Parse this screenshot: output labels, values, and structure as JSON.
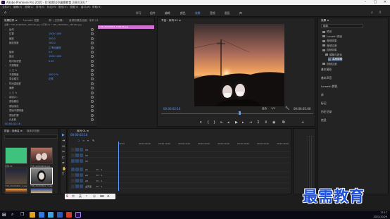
{
  "window": {
    "title": "Adobe Premiere Pro 2020 - D:\\视频\\10\\最需教育 2(8)\\(30).*",
    "controls": [
      "–",
      "□",
      "✕"
    ]
  },
  "menu": [
    "文件(F)",
    "编辑(E)",
    "剪辑(C)",
    "序列(S)",
    "标记(M)",
    "图形(G)",
    "视图(V)",
    "窗口(W)",
    "帮助(H)"
  ],
  "workspaces": {
    "items": [
      "学习",
      "组件",
      "编辑",
      "颜色",
      "效果",
      "音频",
      "图形",
      "库"
    ],
    "active_index": 4
  },
  "effect_controls": {
    "tabs": [
      "效果控件 ≡",
      "Lumetri 范围",
      "源：(无剪辑)",
      "音频剪辑混合器：序列 01"
    ],
    "source_line": "主要 * Y98_20200601_180146.jpg ∨ 序列 01 * Y98_20200601_180146.jpg",
    "clip_name": "Y98_20200601_180146.jpg",
    "rows": [
      {
        "label": "运动",
        "value": ""
      },
      {
        "label": "位置",
        "value": "1500   1000"
      },
      {
        "label": "缩放",
        "value": "200.0"
      },
      {
        "label": "缩放宽度",
        "value": "100.0"
      },
      {
        "label": "",
        "value": "☑ 等比缩放"
      },
      {
        "label": "旋转",
        "value": "0.0"
      },
      {
        "label": "锚点",
        "value": "1500   1000"
      },
      {
        "label": "防闪烁滤镜",
        "value": "0.00"
      },
      {
        "label": "不透明度",
        "value": ""
      },
      {
        "label": "○ □ ✎",
        "value": ""
      },
      {
        "label": "不透明度",
        "value": "100.0 %"
      },
      {
        "label": "混合模式",
        "value": "正常"
      },
      {
        "label": "时间重映射",
        "value": ""
      },
      {
        "label": "偏移",
        "value": ""
      },
      {
        "label": "○ □ ✎",
        "value": ""
      },
      {
        "label": "蒙版(1)",
        "value": ""
      },
      {
        "label": "  蒙版路径",
        "value": ""
      },
      {
        "label": "  蒙版羽化",
        "value": ""
      },
      {
        "label": "  蒙版不透明度",
        "value": ""
      },
      {
        "label": "  蒙版扩展",
        "value": ""
      },
      {
        "label": "  已反转",
        "value": ""
      }
    ],
    "time": "00:00:02:16"
  },
  "program_monitor": {
    "tab": "节目：序列 01 ≡",
    "timecode": "00:00:02:16",
    "fit": "适合",
    "fraction": "1/2",
    "duration": "00:00:05:00"
  },
  "project": {
    "tab": "效果 ≡",
    "search_placeholder": "模糊",
    "items": [
      "预设",
      "Lumetri 预设",
      "音频效果",
      "音频过渡",
      "视频效果",
      "模糊与锐化",
      "高斯模糊",
      "视频过渡"
    ],
    "sections": [
      "基本图形",
      "基本声音",
      "Lumetri 颜色",
      "库",
      "标记",
      "历史记录",
      "信息"
    ]
  },
  "project_bin": {
    "tabs": [
      "项目：未命名 ≡",
      "媒体浏览器"
    ],
    "thumbs": [
      {
        "name": "序列 01",
        "meta": "5:00"
      },
      {
        "name": "Y98_20200601.jpg",
        "meta": "5:00"
      },
      {
        "name": "Y98_20200601_2.jpg",
        "meta": "5:00"
      },
      {
        "name": "Y98_20200601_3.jpg",
        "meta": "5:00"
      }
    ]
  },
  "tools": [
    "▶",
    "⇥",
    "⇔",
    "✂",
    "⊏",
    "✒",
    "✋",
    "T"
  ],
  "timeline": {
    "tab": "序列 01 ≡",
    "timecode": "00:00:02:16",
    "ruler": [
      "00:00",
      "00:00:05:00",
      "00:00:10:00",
      "00:00:15:00",
      "00:00:20:00",
      "00:00:25:00",
      "00:00:30:00",
      "00:00:35:00",
      "00:00:40:00"
    ],
    "tracks": [
      "V3",
      "V2",
      "V1",
      "A1",
      "A2",
      "A3",
      "主声道"
    ]
  },
  "ime": {
    "label": "中",
    "items": [
      "英",
      "º",
      "☺",
      "⌨",
      "⚙"
    ]
  },
  "taskbar": {
    "time": "17:17",
    "date": "2021/10/29"
  },
  "watermark": "最需教育",
  "colors": {
    "accent": "#5d9bff",
    "clip": "#d271d4",
    "brand_blue": "#1e4fd6"
  }
}
